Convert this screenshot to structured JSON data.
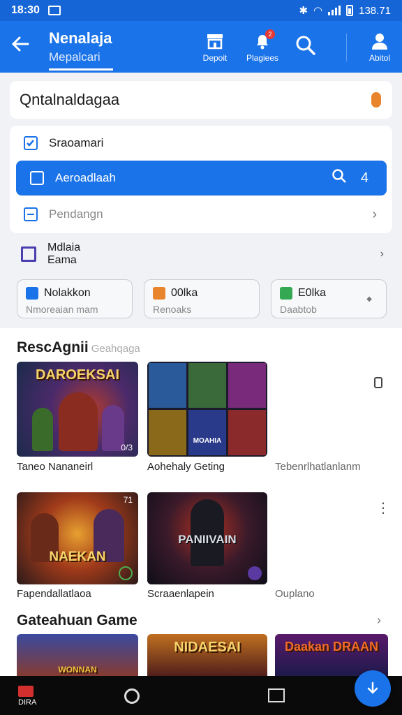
{
  "status_bar": {
    "time": "18:30",
    "right_text": "138.71"
  },
  "app_bar": {
    "title": "Nenalaja",
    "subtitle": "Mepalcari",
    "actions": [
      {
        "label": "Depoit",
        "icon": "store-icon"
      },
      {
        "label": "Plagiees",
        "icon": "notification-icon",
        "badge": "2"
      },
      {
        "label": "",
        "icon": "search-icon"
      },
      {
        "label": "Abitol",
        "icon": "profile-icon"
      }
    ]
  },
  "search": {
    "value": "Qntalnaldagaa",
    "icon": "mic-icon"
  },
  "menu": {
    "items": [
      {
        "label": "Sraoamari",
        "icon": "checkbox-icon"
      },
      {
        "label": "Aeroadlaah",
        "icon": "checkbox-icon",
        "count": "4",
        "active": true
      },
      {
        "label": "Pendangn",
        "icon": "minus-square-icon"
      }
    ]
  },
  "media_row": {
    "line1": "Mdlaia",
    "line2": "Eama"
  },
  "chips": [
    {
      "title": "Nolakkon",
      "subtitle": "Nmoreaian mam",
      "color": "#1a73e8"
    },
    {
      "title": "00lka",
      "subtitle": "Renoaks",
      "color": "#e8842c"
    },
    {
      "title": "E0lka",
      "subtitle": "Daabtob",
      "color": "#34a853"
    }
  ],
  "section1": {
    "title": "RescAgnii",
    "subtitle": "Geahqaga",
    "row1": [
      {
        "caption": "Taneo Nananeirl",
        "art_title": "DAROEKSAI",
        "badge": "0/3"
      },
      {
        "caption": "Aohehaly Geting",
        "art_title": "MOAHIA"
      },
      {
        "caption": "Tebenrlhatlanlanm"
      }
    ],
    "row2": [
      {
        "caption": "Fapendallatlaoa",
        "art_title": "NAEKAN",
        "corner": "71"
      },
      {
        "caption": "Scraaenlapein",
        "art_title": "PANIIVAIN"
      },
      {
        "caption": "Ouplano"
      }
    ]
  },
  "section2": {
    "title": "Gateahuan Game",
    "games": [
      {
        "art_title": "WONNAN"
      },
      {
        "art_title": "NIDAESAI"
      },
      {
        "art_title": "Daakan DRAAN"
      }
    ]
  },
  "bottom_nav": {
    "home_label": "DIRA"
  },
  "colors": {
    "primary": "#1a73e8",
    "status_bar": "#1565d6",
    "accent_orange": "#e8842c",
    "accent_green": "#34a853"
  }
}
